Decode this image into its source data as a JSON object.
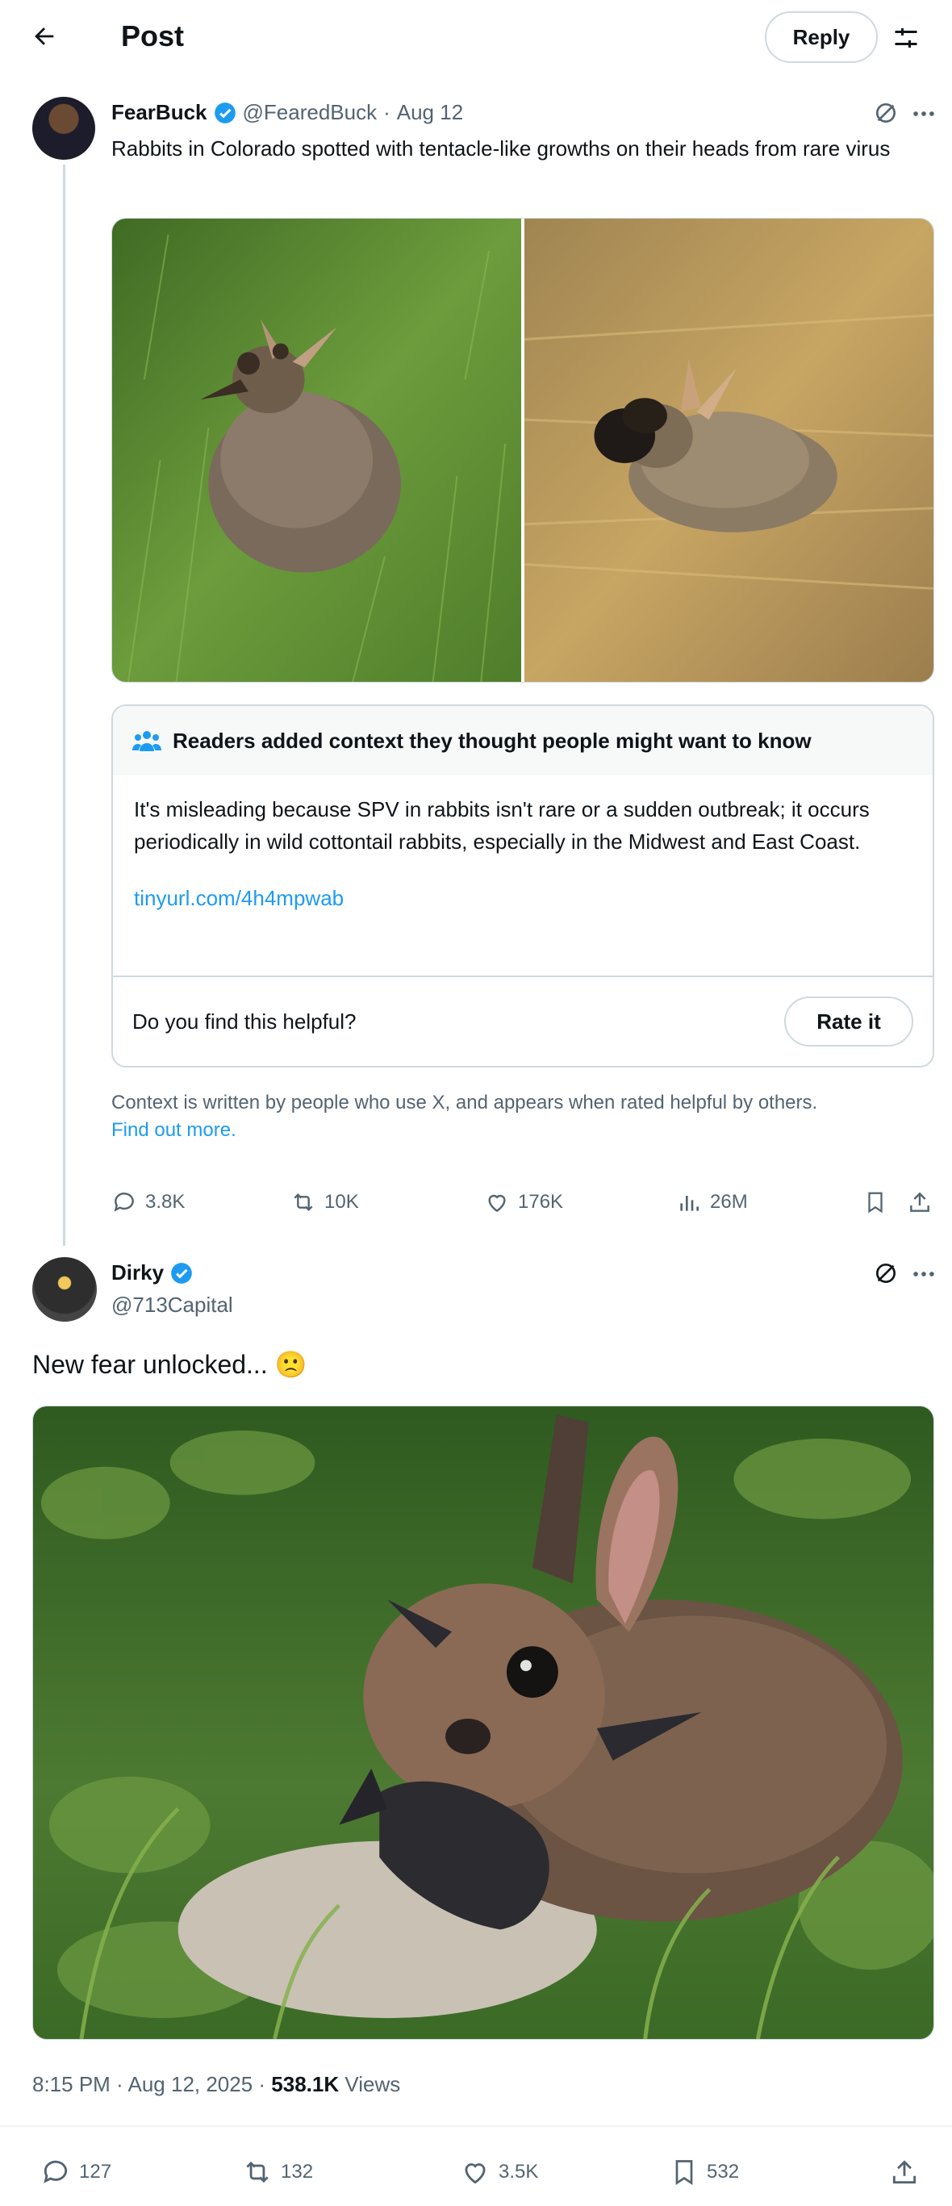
{
  "header": {
    "title": "Post",
    "reply_label": "Reply"
  },
  "post1": {
    "name": "FearBuck",
    "handle": "@FearedBuck",
    "separator": "·",
    "date": "Aug 12",
    "text": "Rabbits in Colorado spotted with tentacle-like growths on their heads from rare virus",
    "note": {
      "header": "Readers added context they thought people might want to know",
      "body": "It's misleading because SPV in rabbits isn't rare or a sudden outbreak; it occurs periodically in wild cottontail rabbits, especially in the Midwest and East Coast.",
      "link": "tinyurl.com/4h4mpwab",
      "question": "Do you find this helpful?",
      "rate_label": "Rate it"
    },
    "disclaimer": "Context is written by people who use X, and appears when rated helpful by others.",
    "find_out_more": "Find out more.",
    "stats": {
      "replies": "3.8K",
      "reposts": "10K",
      "likes": "176K",
      "views": "26M"
    }
  },
  "post2": {
    "name": "Dirky",
    "handle": "@713Capital",
    "text": "New fear unlocked...",
    "emoji": "🙁",
    "time": "8:15 PM · Aug 12, 2025 · ",
    "views_count": "538.1K",
    "views_label": " Views",
    "stats": {
      "replies": "127",
      "reposts": "132",
      "likes": "3.5K",
      "bookmarks": "532"
    }
  },
  "colors": {
    "accent": "#1d9bf0",
    "verified": "#1d9bf0",
    "text": "#0f1419",
    "muted": "#536471",
    "border": "#cfd9de"
  },
  "icons": [
    "back-arrow-icon",
    "filter-icon",
    "verified-icon",
    "grok-icon",
    "more-icon",
    "community-notes-icon",
    "reply-icon",
    "repost-icon",
    "like-icon",
    "views-icon",
    "bookmark-icon",
    "share-icon"
  ]
}
